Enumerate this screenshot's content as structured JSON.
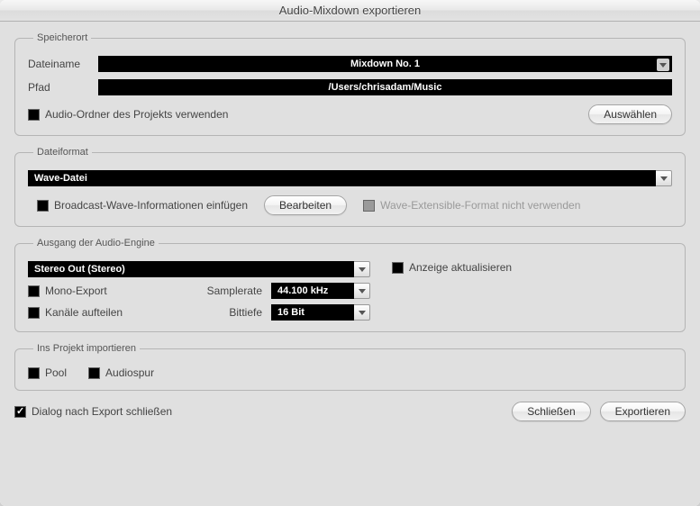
{
  "window": {
    "title": "Audio-Mixdown exportieren"
  },
  "storage": {
    "legend": "Speicherort",
    "filename_label": "Dateiname",
    "filename_value": "Mixdown No. 1",
    "path_label": "Pfad",
    "path_value": "/Users/chrisadam/Music",
    "use_project_folder_label": "Audio-Ordner des Projekts verwenden",
    "choose_button": "Auswählen"
  },
  "format": {
    "legend": "Dateiformat",
    "selected": "Wave-Datei",
    "broadcast_label": "Broadcast-Wave-Informationen einfügen",
    "edit_button": "Bearbeiten",
    "wave_ext_label": "Wave-Extensible-Format nicht verwenden"
  },
  "engine": {
    "legend": "Ausgang der Audio-Engine",
    "output_selected": "Stereo Out (Stereo)",
    "mono_label": "Mono-Export",
    "split_label": "Kanäle aufteilen",
    "samplerate_label": "Samplerate",
    "samplerate_value": "44.100 kHz",
    "bitdepth_label": "Bittiefe",
    "bitdepth_value": "16 Bit",
    "update_display_label": "Anzeige aktualisieren"
  },
  "import": {
    "legend": "Ins Projekt importieren",
    "pool_label": "Pool",
    "track_label": "Audiospur"
  },
  "footer": {
    "close_after_label": "Dialog nach Export schließen",
    "close_button": "Schließen",
    "export_button": "Exportieren"
  }
}
